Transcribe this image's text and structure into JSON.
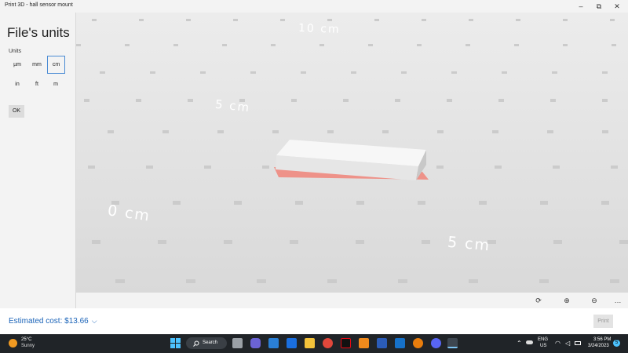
{
  "window": {
    "title": "Print 3D - hall sensor mount"
  },
  "window_controls": {
    "minimize": "–",
    "maximize": "⧉",
    "close": "✕"
  },
  "left_panel": {
    "title": "File's units",
    "units_label": "Units",
    "units": [
      "µm",
      "mm",
      "cm",
      "in",
      "ft",
      "m"
    ],
    "selected_unit": "cm",
    "ok_label": "OK"
  },
  "viewport": {
    "labels": [
      "10 cm",
      "5 cm",
      "0 cm",
      "5 cm"
    ]
  },
  "toolbar": {
    "icons": [
      "camera-icon",
      "zoom-in-icon",
      "zoom-out-icon",
      "more-icon"
    ],
    "glyphs": {
      "camera": "⟳",
      "zoom_in": "⊕",
      "zoom_out": "⊖",
      "more": "…"
    }
  },
  "footer": {
    "cost_label": "Estimated cost: $13.66",
    "chevron": "⌵",
    "print_label": "Print"
  },
  "taskbar": {
    "weather_temp": "25°C",
    "weather_condition": "Sunny",
    "search_label": "Search",
    "language": "ENG",
    "region": "US",
    "time": "3:56 PM",
    "date": "3/24/2023",
    "notification_count": "5",
    "colors": {
      "accent": "#1a63b8",
      "taskbar": "#202428",
      "bed_edge": "#f08a80"
    }
  }
}
